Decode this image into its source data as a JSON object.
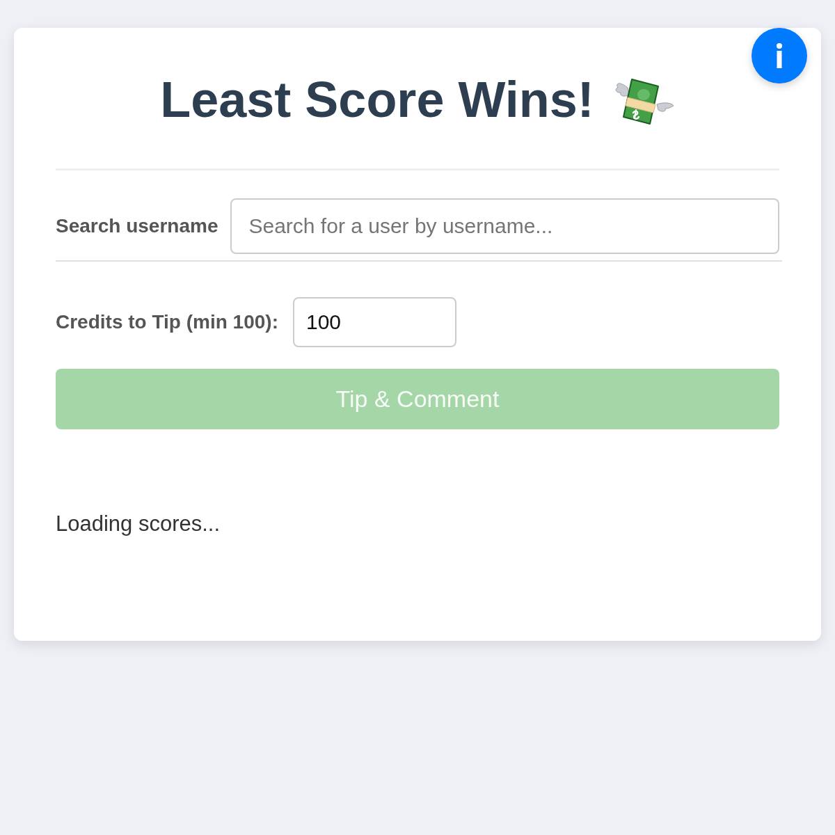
{
  "title": "Least Score Wins!",
  "search": {
    "label": "Search username",
    "placeholder": "Search for a user by username..."
  },
  "tip": {
    "label": "Credits to Tip (min 100):",
    "value": "100"
  },
  "submit_button": {
    "label": "Tip & Comment",
    "disabled": true
  },
  "status": "Loading scores..."
}
